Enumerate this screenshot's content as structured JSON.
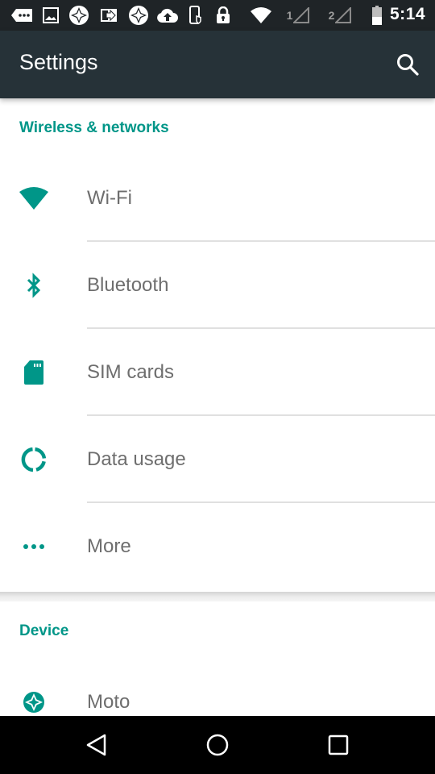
{
  "status_bar": {
    "time": "5:14",
    "sim1_label": "1",
    "sim2_label": "2",
    "icons": [
      "message-icon",
      "image-icon",
      "moto-icon",
      "transfer-icon",
      "moto-icon",
      "cloud-upload-icon",
      "phone-shield-icon",
      "lock-icon",
      "wifi-signal-icon",
      "sim1-signal-icon",
      "sim2-signal-icon",
      "battery-icon"
    ]
  },
  "app_bar": {
    "title": "Settings",
    "search_icon": "search-icon"
  },
  "colors": {
    "accent": "#009688",
    "app_bar": "#263238",
    "status_bar": "#1f2427",
    "label_text": "#6e6e6e"
  },
  "sections": [
    {
      "header": "Wireless & networks",
      "items": [
        {
          "label": "Wi-Fi",
          "icon": "wifi-icon"
        },
        {
          "label": "Bluetooth",
          "icon": "bluetooth-icon"
        },
        {
          "label": "SIM cards",
          "icon": "sim-card-icon"
        },
        {
          "label": "Data usage",
          "icon": "data-usage-icon"
        },
        {
          "label": "More",
          "icon": "more-icon"
        }
      ]
    },
    {
      "header": "Device",
      "items": [
        {
          "label": "Moto",
          "icon": "moto-icon"
        }
      ]
    }
  ],
  "nav_bar": {
    "back": "back-icon",
    "home": "home-icon",
    "recents": "recents-icon"
  }
}
